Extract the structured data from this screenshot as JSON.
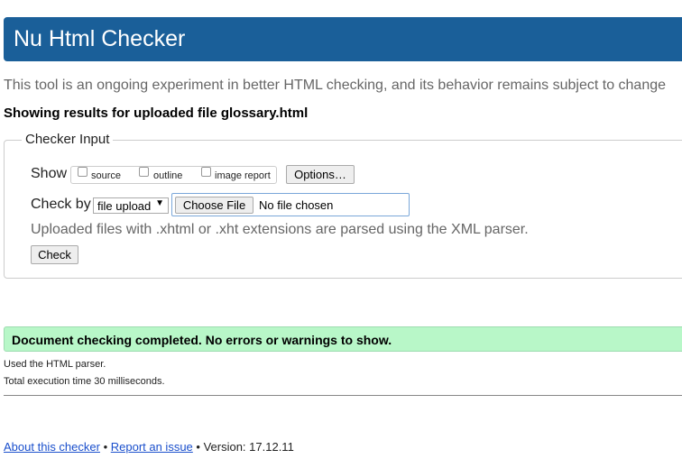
{
  "header": {
    "title": "Nu Html Checker"
  },
  "intro": "This tool is an ongoing experiment in better HTML checking, and its behavior remains subject to change",
  "results_title": "Showing results for uploaded file glossary.html",
  "checker_input": {
    "legend": "Checker Input",
    "show_label": "Show",
    "show_options": [
      {
        "label": "source",
        "checked": false
      },
      {
        "label": "outline",
        "checked": false
      },
      {
        "label": "image report",
        "checked": false
      }
    ],
    "options_button": "Options…",
    "check_by_label": "Check by",
    "check_by_selected": "file upload",
    "choose_file_button": "Choose File",
    "file_status": "No file chosen",
    "hint": "Uploaded files with .xhtml or .xht extensions are parsed using the XML parser.",
    "check_button": "Check"
  },
  "result": {
    "message": "Document checking completed. No errors or warnings to show.",
    "color": "#b8f7c8"
  },
  "details": {
    "parser": "Used the HTML parser.",
    "execution": "Total execution time 30 milliseconds."
  },
  "footer": {
    "about_link": "About this checker",
    "sep1": " • ",
    "report_link": "Report an issue",
    "version": " • Version: 17.12.11"
  },
  "colors": {
    "header_bg": "#1a5f99",
    "link": "#1a4fcc"
  }
}
